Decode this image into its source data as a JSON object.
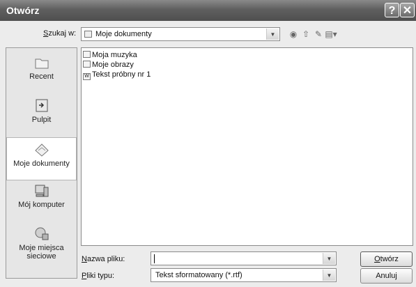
{
  "window": {
    "title": "Otwórz",
    "help_glyph": "?",
    "close_glyph": "✕"
  },
  "lookin": {
    "label_prefix": "S",
    "label_rest": "zukaj w:",
    "value": "Moje dokumenty"
  },
  "toolbar": {
    "icons": [
      "back-icon",
      "up-folder-icon",
      "new-folder-icon",
      "view-menu-icon"
    ]
  },
  "places": [
    {
      "label": "Recent",
      "icon": "recent-icon"
    },
    {
      "label": "Pulpit",
      "icon": "desktop-icon"
    },
    {
      "label": "Moje dokumenty",
      "icon": "my-documents-icon"
    },
    {
      "label": "Mój komputer",
      "icon": "my-computer-icon"
    },
    {
      "label": "Moje miejsca sieciowe",
      "icon": "network-places-icon"
    }
  ],
  "files": [
    {
      "name": "Moja muzyka",
      "icon": "folder-icon"
    },
    {
      "name": "Moje obrazy",
      "icon": "folder-icon"
    },
    {
      "name": "Tekst próbny nr 1",
      "icon": "rtf-file-icon"
    }
  ],
  "filename": {
    "label_prefix": "N",
    "label_rest": "azwa pliku:",
    "value": ""
  },
  "filetype": {
    "label_prefix": "P",
    "label_rest": "liki typu:",
    "value": "Tekst sformatowany (*.rtf)"
  },
  "buttons": {
    "open_prefix": "O",
    "open_rest": "twórz",
    "cancel": "Anuluj"
  }
}
